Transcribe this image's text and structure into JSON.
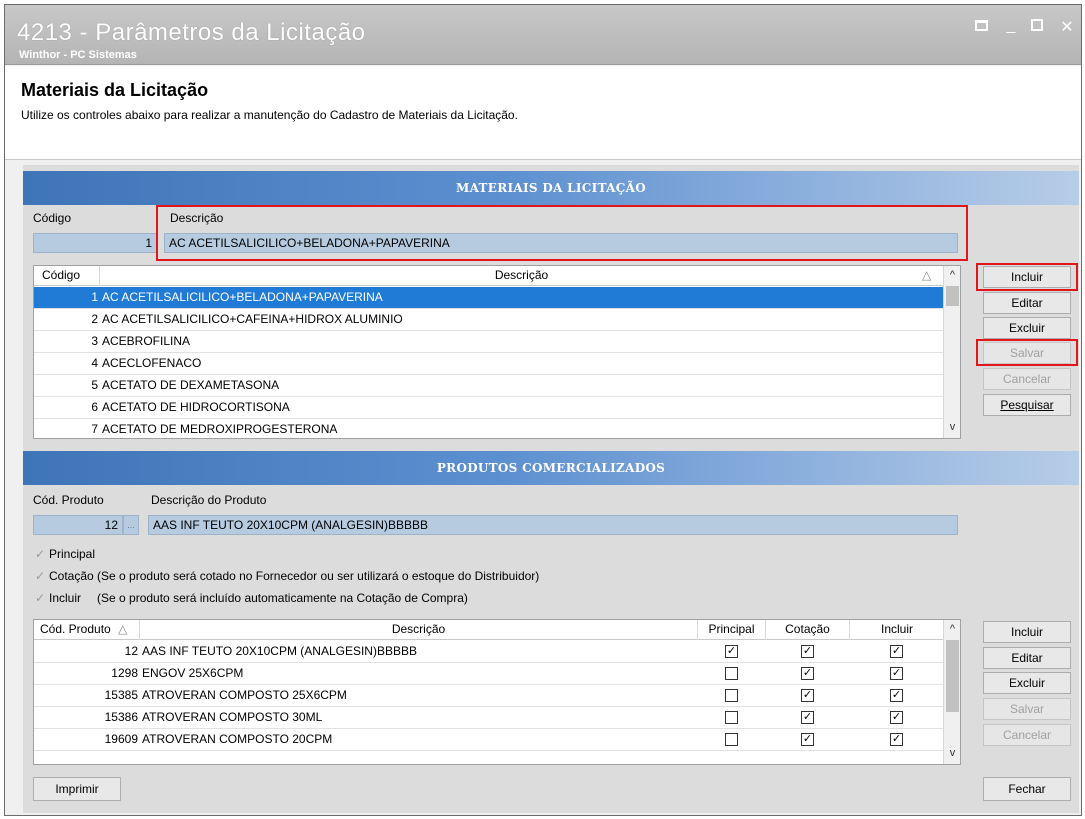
{
  "window": {
    "title": "4213 - Parâmetros da Licitação",
    "subtitle": "Winthor - PC Sistemas"
  },
  "header": {
    "heading": "Materiais da Licitação",
    "description": "Utilize os controles abaixo para realizar a manutenção do Cadastro de Materiais da Licitação."
  },
  "materials": {
    "section_title": "MATERIAIS DA LICITAÇÃO",
    "code_label": "Código",
    "desc_label": "Descrição",
    "code_value": "1",
    "desc_value": "AC ACETILSALICILICO+BELADONA+PAPAVERINA",
    "grid": {
      "col_code": "Código",
      "col_desc": "Descrição",
      "rows": [
        {
          "code": "1",
          "desc": "AC ACETILSALICILICO+BELADONA+PAPAVERINA"
        },
        {
          "code": "2",
          "desc": "AC ACETILSALICILICO+CAFEINA+HIDROX ALUMINIO"
        },
        {
          "code": "3",
          "desc": "ACEBROFILINA"
        },
        {
          "code": "4",
          "desc": "ACECLOFENACO"
        },
        {
          "code": "5",
          "desc": "ACETATO DE DEXAMETASONA"
        },
        {
          "code": "6",
          "desc": "ACETATO DE HIDROCORTISONA"
        },
        {
          "code": "7",
          "desc": "ACETATO DE MEDROXIPROGESTERONA"
        }
      ]
    },
    "buttons": {
      "incluir": "Incluir",
      "editar": "Editar",
      "excluir": "Excluir",
      "salvar": "Salvar",
      "cancelar": "Cancelar",
      "pesquisar": "Pesquisar"
    }
  },
  "products": {
    "section_title": "PRODUTOS COMERCIALIZADOS",
    "code_label": "Cód. Produto",
    "desc_label": "Descrição do Produto",
    "code_value": "12",
    "lookup_glyph": "...",
    "desc_value": "AAS INF TEUTO 20X10CPM (ANALGESIN)BBBBB",
    "options": {
      "principal": "Principal",
      "cotacao": "Cotação (Se o produto será cotado no Fornecedor ou ser utilizará o estoque do Distribuidor)",
      "incluir": "Incluir",
      "incluir_note": "(Se o produto será incluído automaticamente na Cotação de Compra)"
    },
    "grid": {
      "col_code": "Cód. Produto",
      "col_desc": "Descrição",
      "col_principal": "Principal",
      "col_cotacao": "Cotação",
      "col_incluir": "Incluir",
      "rows": [
        {
          "code": "12",
          "desc": "AAS INF TEUTO 20X10CPM (ANALGESIN)BBBBB",
          "principal": true,
          "cotacao": true,
          "incluir": true
        },
        {
          "code": "1298",
          "desc": "ENGOV 25X6CPM",
          "principal": false,
          "cotacao": true,
          "incluir": true
        },
        {
          "code": "15385",
          "desc": "ATROVERAN COMPOSTO 25X6CPM",
          "principal": false,
          "cotacao": true,
          "incluir": true
        },
        {
          "code": "15386",
          "desc": "ATROVERAN COMPOSTO 30ML",
          "principal": false,
          "cotacao": true,
          "incluir": true
        },
        {
          "code": "19609",
          "desc": "ATROVERAN COMPOSTO 20CPM",
          "principal": false,
          "cotacao": true,
          "incluir": true
        }
      ]
    },
    "buttons": {
      "incluir": "Incluir",
      "editar": "Editar",
      "excluir": "Excluir",
      "salvar": "Salvar",
      "cancelar": "Cancelar"
    }
  },
  "footer": {
    "imprimir": "Imprimir",
    "fechar": "Fechar"
  },
  "icons": {
    "sort_asc": "△",
    "scroll_up": "^",
    "scroll_down": "v",
    "check": "✓",
    "checkbox_checked": "☑"
  },
  "colors": {
    "selection": "#1f7bd6",
    "highlight_box": "#e0161b",
    "section_bar": "#3e75b8"
  }
}
